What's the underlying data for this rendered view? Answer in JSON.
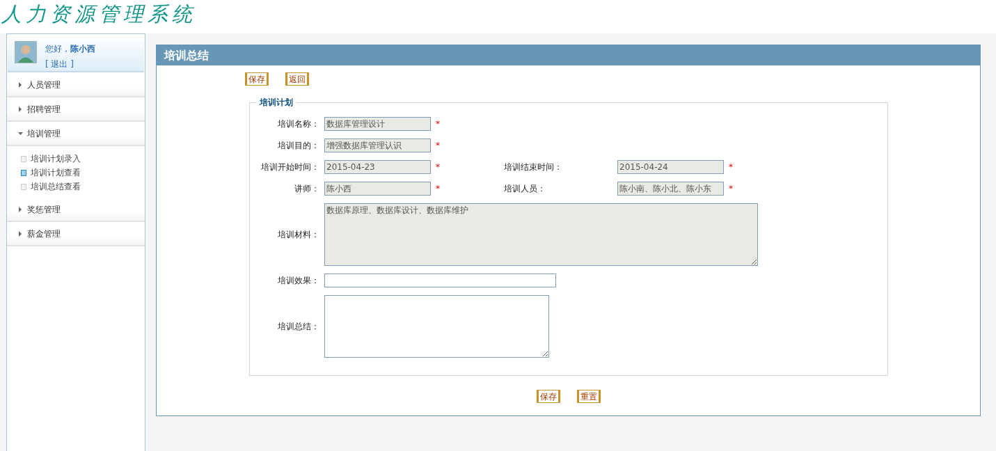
{
  "header": {
    "logo": "人力资源管理系统"
  },
  "user": {
    "greeting": "您好，",
    "name": "陈小西",
    "logout": "[ 退出 ]"
  },
  "sidebar": {
    "items": [
      {
        "label": "人员管理",
        "expanded": false
      },
      {
        "label": "招聘管理",
        "expanded": false
      },
      {
        "label": "培训管理",
        "expanded": true,
        "children": [
          {
            "label": "培训计划录入",
            "selected": false
          },
          {
            "label": "培训计划查看",
            "selected": true
          },
          {
            "label": "培训总结查看",
            "selected": false
          }
        ]
      },
      {
        "label": "奖惩管理",
        "expanded": false
      },
      {
        "label": "薪金管理",
        "expanded": false
      }
    ]
  },
  "panel": {
    "title": "培训总结",
    "top_buttons": [
      "保存",
      "返回"
    ],
    "fieldset": {
      "legend": "培训计划",
      "rows": [
        {
          "fields": [
            {
              "kind": "input",
              "label": "培训名称：",
              "value": "数据库管理设计",
              "readonly": true,
              "required_mark": "*"
            }
          ]
        },
        {
          "fields": [
            {
              "kind": "input",
              "label": "培训目的：",
              "value": "增强数据库管理认识",
              "readonly": true,
              "required_mark": "*"
            }
          ]
        },
        {
          "fields": [
            {
              "kind": "input",
              "label": "培训开始时间：",
              "value": "2015-04-23",
              "readonly": true,
              "required_mark": "*"
            },
            {
              "kind": "input",
              "label": "培训结束时间：",
              "value": "2015-04-24",
              "readonly": true,
              "required_mark": "*"
            }
          ]
        },
        {
          "fields": [
            {
              "kind": "input",
              "label": "讲师：",
              "value": "陈小西",
              "readonly": true,
              "required_mark": "*"
            },
            {
              "kind": "input",
              "label": "培训人员：",
              "value": "陈小南、陈小北、陈小东",
              "readonly": true,
              "required_mark": "*"
            }
          ]
        },
        {
          "fields": [
            {
              "kind": "textarea",
              "label": "培训材料：",
              "value": "数据库原理、数据库设计、数据库维护",
              "readonly": true
            }
          ]
        },
        {
          "fields": [
            {
              "kind": "input",
              "label": "培训效果：",
              "readonly": false
            }
          ]
        },
        {
          "fields": [
            {
              "kind": "textarea",
              "label": "培训总结：",
              "readonly": false
            }
          ]
        }
      ]
    },
    "bottom_buttons": [
      "保存",
      "重置"
    ]
  }
}
